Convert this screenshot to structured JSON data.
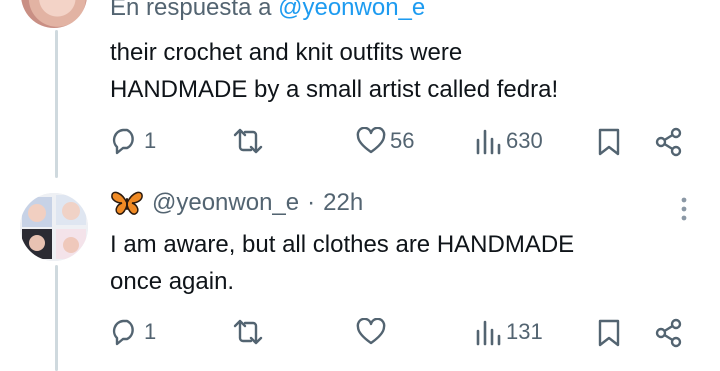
{
  "tweet1": {
    "reply_prefix": "En respuesta a",
    "reply_mention": "@yeonwon_e",
    "text_line1": "their crochet and knit outfits were",
    "text_line2": "HANDMADE by a small artist called fedra!",
    "actions": {
      "replies": "1",
      "reposts": "",
      "likes": "56",
      "views": "630"
    }
  },
  "tweet2": {
    "handle": "@yeonwon_e",
    "separator": "·",
    "time": "22h",
    "text_line1": "I am aware, but all clothes are HANDMADE",
    "text_line2": "once again.",
    "actions": {
      "replies": "1",
      "reposts": "",
      "likes": "",
      "views": "131"
    }
  },
  "icons": {
    "reply": "reply-icon",
    "repost": "repost-icon",
    "like": "heart-icon",
    "views": "views-icon",
    "bookmark": "bookmark-icon",
    "share": "share-icon",
    "more": "more-icon",
    "butterfly": "butterfly-emoji"
  },
  "colors": {
    "text": "#0f1419",
    "secondary": "#536471",
    "link": "#1d9bf0",
    "thread_line": "#cfd9de"
  }
}
